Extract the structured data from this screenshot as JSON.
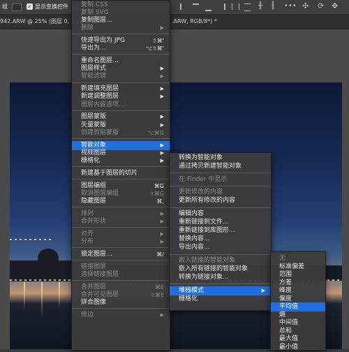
{
  "options_bar": {
    "partial_label": "组",
    "show_transform_label": "显示变换控件"
  },
  "doc_tabs": [
    "942.ARW @ 25% (图层 0, RGB/8*)",
    ".ARW, RGB/8*) *"
  ],
  "menu_main": [
    {
      "label": "复制 CSS",
      "state": "disabled"
    },
    {
      "label": "复制 SVG",
      "state": "disabled"
    },
    {
      "label": "复制图层...",
      "state": "enabled"
    },
    {
      "label": "删除",
      "state": "disabled",
      "arrow": true
    },
    {
      "sep": true
    },
    {
      "label": "快速导出为 JPG",
      "shortcut": "⇧⌘'",
      "state": "enabled"
    },
    {
      "label": "导出为...",
      "shortcut": "⌥⇧⌘'",
      "state": "enabled"
    },
    {
      "sep": true
    },
    {
      "label": "重命名图层...",
      "state": "enabled"
    },
    {
      "label": "图层样式",
      "state": "enabled",
      "arrow": true
    },
    {
      "label": "智能滤镜",
      "state": "disabled",
      "arrow": true
    },
    {
      "sep": true
    },
    {
      "label": "新建填充图层",
      "state": "enabled",
      "arrow": true
    },
    {
      "label": "新建调整图层",
      "state": "enabled",
      "arrow": true
    },
    {
      "label": "图层内容选项...",
      "state": "disabled"
    },
    {
      "sep": true
    },
    {
      "label": "图层蒙版",
      "state": "enabled",
      "arrow": true
    },
    {
      "label": "矢量蒙版",
      "state": "enabled",
      "arrow": true
    },
    {
      "label": "创建剪贴蒙版",
      "shortcut": "⌥⌘G",
      "state": "disabled"
    },
    {
      "sep": true
    },
    {
      "label": "智能对象",
      "state": "selected",
      "arrow": true
    },
    {
      "label": "视频图层",
      "state": "enabled",
      "arrow": true
    },
    {
      "label": "栅格化",
      "state": "enabled",
      "arrow": true
    },
    {
      "sep": true
    },
    {
      "label": "新建基于图层的切片",
      "state": "enabled"
    },
    {
      "sep": true
    },
    {
      "label": "图层编组",
      "shortcut": "⌘G",
      "state": "enabled"
    },
    {
      "label": "取消图层编组",
      "shortcut": "⇧⌘G",
      "state": "disabled"
    },
    {
      "label": "隐藏图层",
      "shortcut": "⌘,",
      "state": "enabled"
    },
    {
      "sep": true
    },
    {
      "label": "排列",
      "state": "disabled",
      "arrow": true
    },
    {
      "label": "合并形状",
      "state": "disabled",
      "arrow": true
    },
    {
      "sep": true
    },
    {
      "label": "对齐",
      "state": "disabled",
      "arrow": true
    },
    {
      "label": "分布",
      "state": "disabled",
      "arrow": true
    },
    {
      "sep": true
    },
    {
      "label": "锁定图层...",
      "shortcut": "⌘/",
      "state": "enabled"
    },
    {
      "sep": true
    },
    {
      "label": "链接图层",
      "state": "disabled"
    },
    {
      "label": "选择链接图层",
      "state": "disabled"
    },
    {
      "sep": true
    },
    {
      "label": "合并图层",
      "shortcut": "⌘E",
      "state": "disabled"
    },
    {
      "label": "合并可见图层",
      "shortcut": "⇧⌘E",
      "state": "disabled"
    },
    {
      "label": "拼合图像",
      "state": "enabled"
    },
    {
      "sep": true
    },
    {
      "label": "修边",
      "state": "disabled",
      "arrow": true
    }
  ],
  "menu_smart_object": [
    {
      "label": "转换为智能对象",
      "state": "enabled"
    },
    {
      "label": "通过拷贝新建智能对象",
      "state": "enabled"
    },
    {
      "sep": true
    },
    {
      "label": "在 Finder 中显示",
      "state": "disabled"
    },
    {
      "sep": true
    },
    {
      "label": "更新修改的内容",
      "state": "disabled"
    },
    {
      "label": "更新所有修改的内容",
      "state": "enabled"
    },
    {
      "sep": true
    },
    {
      "label": "编辑内容",
      "state": "enabled"
    },
    {
      "label": "重新链接到文件...",
      "state": "enabled"
    },
    {
      "label": "重新链接到库图形...",
      "state": "enabled"
    },
    {
      "label": "替换内容...",
      "state": "enabled"
    },
    {
      "label": "导出内容...",
      "state": "enabled"
    },
    {
      "sep": true
    },
    {
      "label": "嵌入链接的智能对象",
      "state": "disabled"
    },
    {
      "label": "嵌入所有链接的智能对象",
      "state": "enabled"
    },
    {
      "label": "转换为链接对象...",
      "state": "enabled"
    },
    {
      "sep": true
    },
    {
      "label": "堆栈模式",
      "state": "selected",
      "arrow": true
    },
    {
      "label": "栅格化",
      "state": "enabled"
    }
  ],
  "menu_stack_mode": [
    {
      "label": "无",
      "state": "disabled"
    },
    {
      "label": "标准偏差",
      "state": "enabled"
    },
    {
      "label": "范围",
      "state": "enabled"
    },
    {
      "label": "方差",
      "state": "enabled"
    },
    {
      "label": "峰度",
      "state": "enabled"
    },
    {
      "label": "偏度",
      "state": "enabled"
    },
    {
      "label": "平均值",
      "state": "selected"
    },
    {
      "label": "熵",
      "state": "enabled"
    },
    {
      "label": "中间值",
      "state": "enabled"
    },
    {
      "label": "总和",
      "state": "enabled"
    },
    {
      "label": "最大值",
      "state": "enabled"
    },
    {
      "label": "最小值",
      "state": "enabled"
    }
  ],
  "colors": {
    "highlight": "#1f6fe0",
    "menu_bg": "#3c3c3e",
    "disabled_text": "#8c8c8c"
  }
}
